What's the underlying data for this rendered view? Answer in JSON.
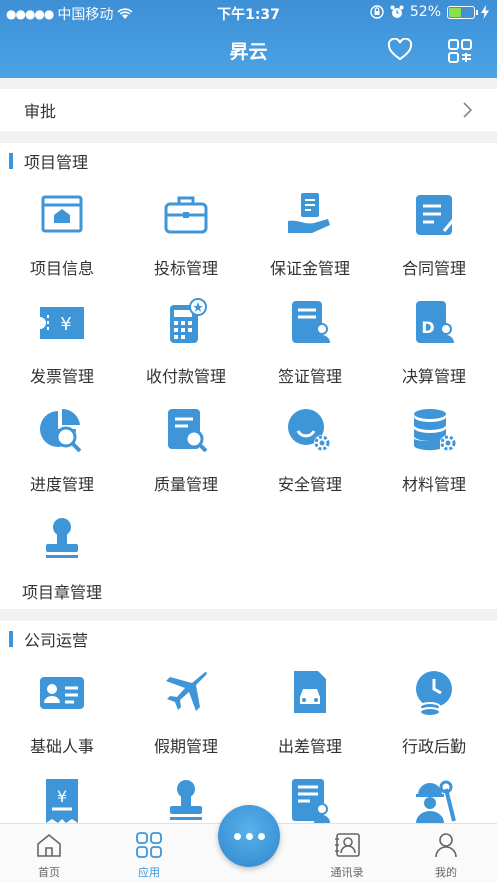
{
  "status_bar": {
    "carrier": "中国移动",
    "time": "下午1:37",
    "battery": "52%",
    "battery_level": 0.52
  },
  "header": {
    "title": "昇云"
  },
  "approval": {
    "label": "审批"
  },
  "project_section": {
    "title": "项目管理",
    "items": [
      {
        "label": "项目信息",
        "icon": "project-info-icon"
      },
      {
        "label": "投标管理",
        "icon": "briefcase-icon"
      },
      {
        "label": "保证金管理",
        "icon": "deposit-icon"
      },
      {
        "label": "合同管理",
        "icon": "contract-icon"
      },
      {
        "label": "发票管理",
        "icon": "invoice-icon"
      },
      {
        "label": "收付款管理",
        "icon": "calculator-icon"
      },
      {
        "label": "签证管理",
        "icon": "visa-icon"
      },
      {
        "label": "决算管理",
        "icon": "settlement-icon"
      },
      {
        "label": "进度管理",
        "icon": "progress-icon"
      },
      {
        "label": "质量管理",
        "icon": "quality-icon"
      },
      {
        "label": "安全管理",
        "icon": "safety-icon"
      },
      {
        "label": "材料管理",
        "icon": "database-gear-icon"
      },
      {
        "label": "项目章管理",
        "icon": "stamp-icon"
      }
    ]
  },
  "company_section": {
    "title": "公司运营",
    "items": [
      {
        "label": "基础人事",
        "icon": "id-card-icon"
      },
      {
        "label": "假期管理",
        "icon": "airplane-icon"
      },
      {
        "label": "出差管理",
        "icon": "car-doc-icon"
      },
      {
        "label": "行政后勤",
        "icon": "clock-coins-icon"
      },
      {
        "label": "",
        "icon": "receipt-icon"
      },
      {
        "label": "",
        "icon": "stamp-icon"
      },
      {
        "label": "",
        "icon": "doc-person-icon"
      },
      {
        "label": "",
        "icon": "worker-icon"
      }
    ]
  },
  "tabbar": {
    "tabs": [
      {
        "label": "首页",
        "icon": "home-icon"
      },
      {
        "label": "应用",
        "icon": "apps-icon"
      },
      {
        "label": "通讯录",
        "icon": "contacts-icon"
      },
      {
        "label": "我的",
        "icon": "person-icon"
      }
    ],
    "active": "应用"
  },
  "colors": {
    "accent": "#3e95d8",
    "header": "#4aa3e4"
  }
}
